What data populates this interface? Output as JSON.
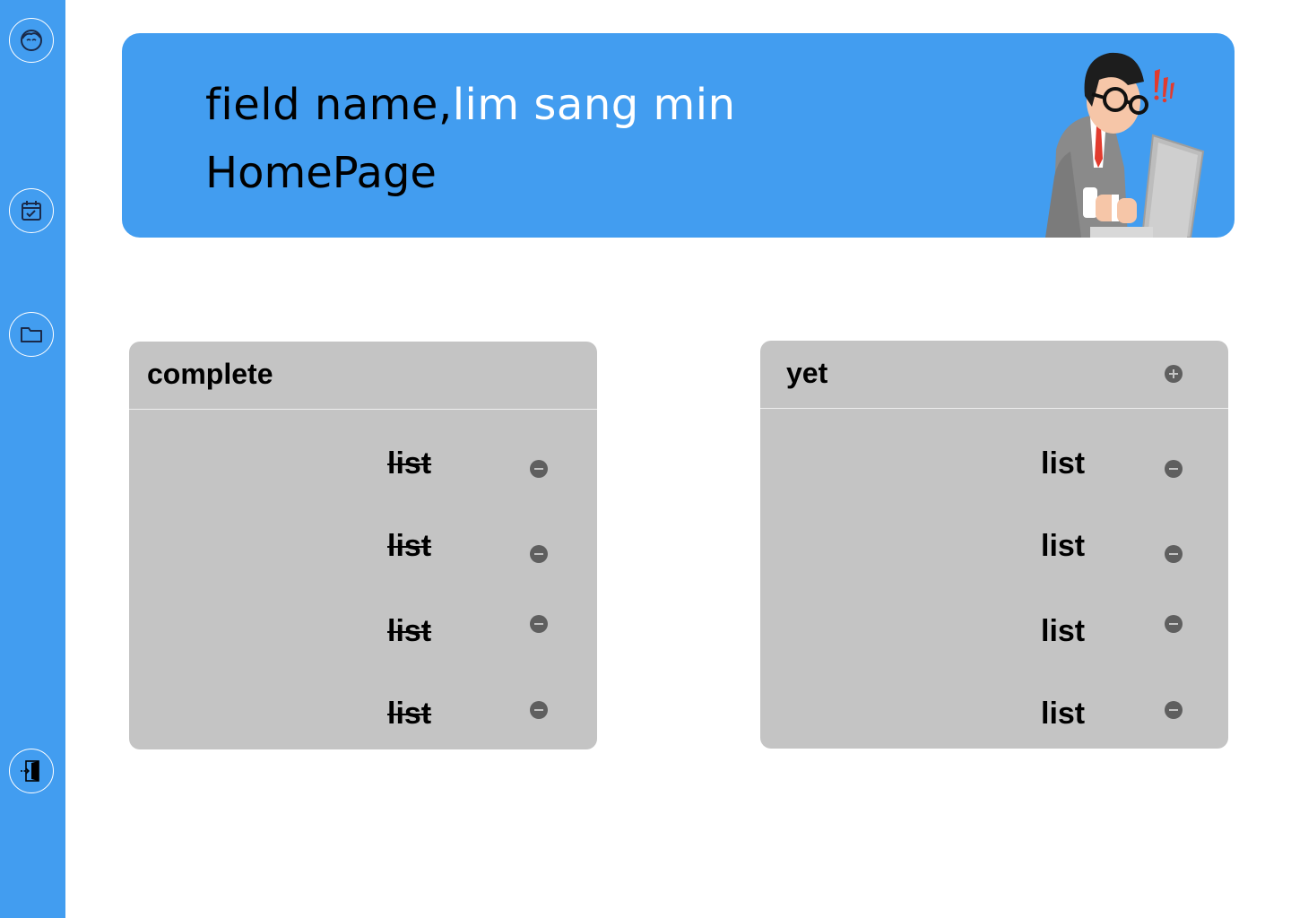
{
  "banner": {
    "greeting_prefix": "field name,",
    "user_name": "lim sang min",
    "page_title": "HomePage"
  },
  "sidebar": {
    "items": [
      {
        "icon": "face-icon"
      },
      {
        "icon": "calendar-check-icon"
      },
      {
        "icon": "folder-icon"
      },
      {
        "icon": "logout-door-icon"
      }
    ]
  },
  "complete": {
    "title": "complete",
    "items": [
      "list",
      "list",
      "list",
      "list"
    ]
  },
  "yet": {
    "title": "yet",
    "items": [
      "list",
      "list",
      "list",
      "list"
    ]
  },
  "colors": {
    "accent": "#429df0",
    "panel": "#c4c4c4",
    "button": "#5f5f5f"
  }
}
